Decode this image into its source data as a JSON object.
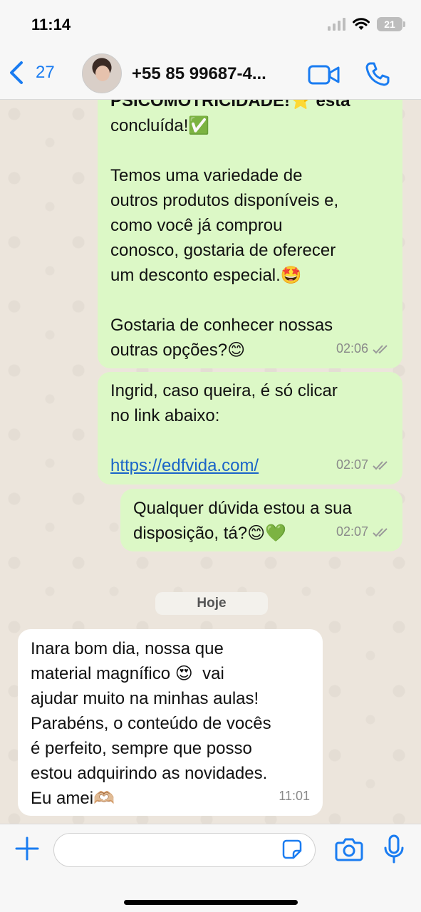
{
  "status_bar": {
    "time": "11:14",
    "battery": "21"
  },
  "header": {
    "back_count": "27",
    "contact_name": "+55 85 99687-4...",
    "accent_color": "#1a7cf1"
  },
  "messages": [
    {
      "direction": "out",
      "line1": "PSICOMOTRICIDADE!⭐ está",
      "line2": "concluída!✅",
      "text": "Temos uma variedade de\noutros produtos disponíveis e,\ncomo você já comprou\nconosco, gostaria de oferecer\num desconto especial.🤩\n\nGostaria de conhecer nossas\noutras opções?😊",
      "time": "02:06"
    },
    {
      "direction": "out",
      "text": "Ingrid, caso queira, é só clicar\nno link abaixo:",
      "link": "https://edfvida.com/",
      "time": "02:07"
    },
    {
      "direction": "out",
      "text": "Qualquer dúvida estou a sua\ndisposição, tá?😊💚",
      "time": "02:07"
    },
    {
      "direction": "in",
      "text": "Inara bom dia, nossa que\nmaterial magnífico 😍  vai\najudar muito na minhas aulas!\nParabéns, o conteúdo de vocês\né perfeito, sempre que posso\nestou adquirindo as novidades.\nEu amei🫶🏼",
      "time": "11:01"
    }
  ],
  "date_divider": "Hoje",
  "composer": {
    "placeholder": ""
  },
  "colors": {
    "outgoing_bubble": "#dcf8c6",
    "incoming_bubble": "#ffffff",
    "link": "#1a64c8",
    "read_ticks": "#9a9a9a"
  }
}
